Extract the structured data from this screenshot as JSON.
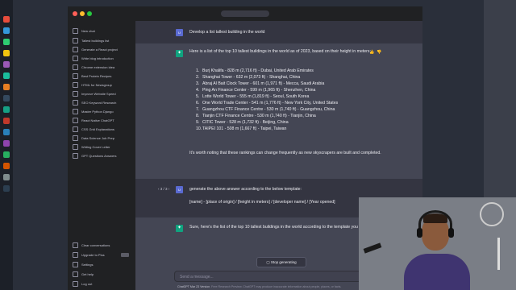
{
  "sidebar": {
    "items": [
      {
        "label": "New chat",
        "icon": "plus-icon"
      },
      {
        "label": "Tallest buildings list",
        "icon": "chat-icon"
      },
      {
        "label": "Generate a React project",
        "icon": "chat-icon"
      },
      {
        "label": "Write blog introduction",
        "icon": "chat-icon"
      },
      {
        "label": "Chrome extension idea",
        "icon": "chat-icon"
      },
      {
        "label": "Best Protein Recipes",
        "icon": "chat-icon"
      },
      {
        "label": "HTML for Newsgroup",
        "icon": "chat-icon"
      },
      {
        "label": "Improve Website Speed",
        "icon": "chat-icon"
      },
      {
        "label": "SEO Keyword Research",
        "icon": "chat-icon"
      },
      {
        "label": "Master Python Django",
        "icon": "chat-icon"
      },
      {
        "label": "React Native ChatGPT",
        "icon": "chat-icon"
      },
      {
        "label": "CSS Grid Explanations",
        "icon": "chat-icon"
      },
      {
        "label": "Data Science Job Prep",
        "icon": "chat-icon"
      },
      {
        "label": "Writing Cover Letter",
        "icon": "chat-icon"
      },
      {
        "label": "GPT Questions Answers",
        "icon": "chat-icon"
      },
      {
        "label": "Clear conversations",
        "icon": "trash-icon"
      },
      {
        "label": "Upgrade to Plus",
        "icon": "user-icon"
      },
      {
        "label": "Settings",
        "icon": "gear-icon"
      },
      {
        "label": "Get help",
        "icon": "help-icon"
      },
      {
        "label": "Log out",
        "icon": "logout-icon"
      }
    ]
  },
  "conversation": {
    "user_1": "Develop a list tallest building in the world",
    "bot_1_intro": "Here is a list of the top 10 tallest buildings in the world as of 2023, based on their height in meters:",
    "buildings": [
      "Burj Khalifa - 828 m (2,716 ft) - Dubai, United Arab Emirates",
      "Shanghai Tower - 632 m (2,073 ft) - Shanghai, China",
      "Abraj Al Bait Clock Tower - 601 m (1,971 ft) - Mecca, Saudi Arabia",
      "Ping An Finance Center - 599 m (1,965 ft) - Shenzhen, China",
      "Lotte World Tower - 555 m (1,819 ft) - Seoul, South Korea",
      "One World Trade Center - 541 m (1,776 ft) - New York City, United States",
      "Guangzhou CTF Finance Centre - 530 m (1,740 ft) - Guangzhou, China",
      "Tianjin CTF Finance Centre - 530 m (1,740 ft) - Tianjin, China",
      "CITIC Tower - 528 m (1,732 ft) - Beijing, China",
      "TAIPEI 101 - 508 m (1,667 ft) - Taipei, Taiwan"
    ],
    "bot_1_outro": "It's worth noting that these rankings can change frequently as new skyscrapers are built and completed.",
    "nav_counter": "‹ 3 / 3 ›",
    "user_2": "generate the above answer according to the below template:",
    "user_2_template": "[name] - [place of origin] / [height in meters] / [developer name] / [Year opened]",
    "bot_2_intro": "Sure, here's the list of the top 10 tallest buildings in the world according to the template you provided:"
  },
  "composer": {
    "stop_label": "Stop generating",
    "placeholder": "Send a message...",
    "footer_link": "ChatGPT Mar 23 Version",
    "footer_text": ". Free Research Preview. ChatGPT may produce inaccurate information about people, places, or facts."
  },
  "colors": {
    "sidebar_bg": "#202123",
    "chat_bg": "#343541",
    "bot_row_bg": "#444654",
    "bot_avatar": "#10a37f",
    "user_avatar": "#5a6ad1"
  }
}
